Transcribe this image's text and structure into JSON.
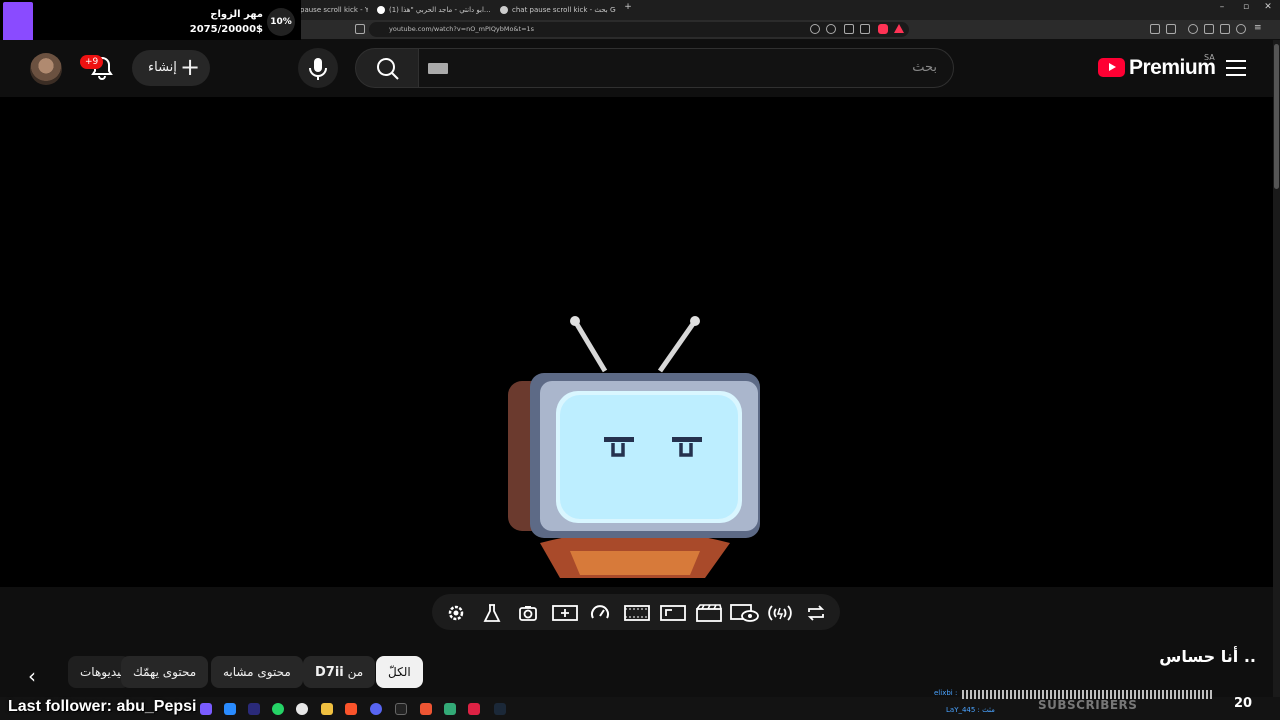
{
  "browser": {
    "tabs": [
      {
        "label": "pause scroll kick - YouTu..."
      },
      {
        "label": "(1) ابو دانتي - ماجد الحربي \"هذا... on X"
      },
      {
        "label": "chat pause scroll kick - بحث Google"
      }
    ],
    "url": "youtube.com/watch?v=nO_mPIQybMo&t=1s"
  },
  "overlay": {
    "goal_title": "مهر الزواج",
    "goal_count": "2075/20000$",
    "goal_percent": "10%",
    "last_follower": "Last follower: abu_Pepsi",
    "subs_label": "SUBSCRIBERS",
    "subs_count": "20",
    "chat_user_1": "elixbi :",
    "chat_user_2": "LaY_445 : مثث",
    "accent": "#8a4bff"
  },
  "header": {
    "notification_badge": "+9",
    "create_label": "إنشاء",
    "search_placeholder": "بحث",
    "brand": "Premium",
    "country": "SA"
  },
  "toolbar_icons": [
    "gear-icon",
    "flask-icon",
    "camera-icon",
    "sparkle-frame-icon",
    "speedometer-icon",
    "film-strip-icon",
    "aspect-ratio-icon",
    "clapper-icon",
    "screen-eye-icon",
    "broadcast-icon",
    "repeat-icon"
  ],
  "chips": {
    "all": "الكلّ",
    "from": "من",
    "channel": "D7ii",
    "similar": "محتوى مشابه",
    "for_you": "محتوى يهمّك",
    "videos": "فيديوهات"
  },
  "video": {
    "title": "أنا حساس .."
  }
}
